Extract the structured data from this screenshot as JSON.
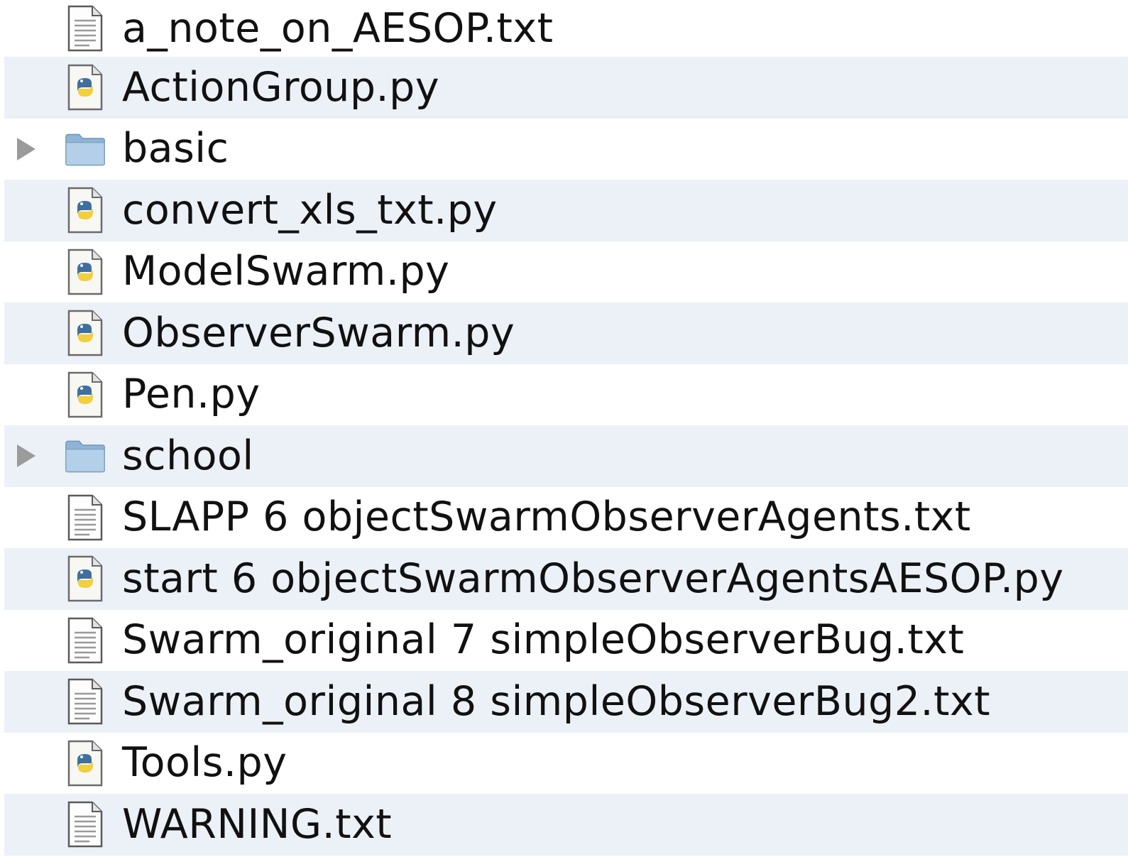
{
  "files": [
    {
      "name": "a_note_on_AESOP.txt",
      "kind": "text",
      "icon": "text-file-icon"
    },
    {
      "name": "ActionGroup.py",
      "kind": "python",
      "icon": "python-file-icon"
    },
    {
      "name": "basic",
      "kind": "folder",
      "icon": "folder-icon"
    },
    {
      "name": "convert_xls_txt.py",
      "kind": "python",
      "icon": "python-file-icon"
    },
    {
      "name": "ModelSwarm.py",
      "kind": "python",
      "icon": "python-file-icon"
    },
    {
      "name": "ObserverSwarm.py",
      "kind": "python",
      "icon": "python-file-icon"
    },
    {
      "name": "Pen.py",
      "kind": "python",
      "icon": "python-file-icon"
    },
    {
      "name": "school",
      "kind": "folder",
      "icon": "folder-icon"
    },
    {
      "name": "SLAPP 6 objectSwarmObserverAgents.txt",
      "kind": "text",
      "icon": "text-file-icon"
    },
    {
      "name": "start 6 objectSwarmObserverAgentsAESOP.py",
      "kind": "python",
      "icon": "python-file-icon"
    },
    {
      "name": "Swarm_original 7 simpleObserverBug.txt",
      "kind": "text",
      "icon": "text-file-icon"
    },
    {
      "name": "Swarm_original 8 simpleObserverBug2.txt",
      "kind": "text",
      "icon": "text-file-icon"
    },
    {
      "name": "Tools.py",
      "kind": "python",
      "icon": "python-file-icon"
    },
    {
      "name": "WARNING.txt",
      "kind": "text",
      "icon": "text-file-icon"
    }
  ],
  "colors": {
    "alternate_row": "#ecf0f7",
    "text": "#111111",
    "folder": "#a9c8e2",
    "disclosure": "#9b9b9b"
  }
}
